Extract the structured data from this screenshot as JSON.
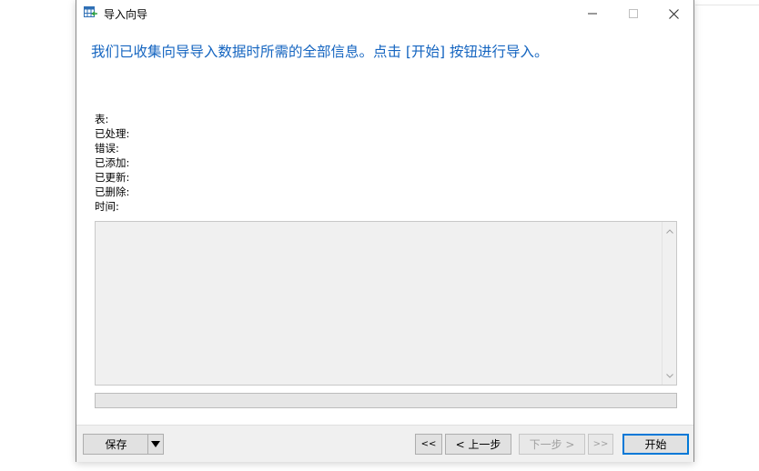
{
  "window": {
    "title": "导入向导",
    "minimize_glyph": "—",
    "maximize_glyph": "☐",
    "close_glyph": "✕"
  },
  "heading": "我们已收集向导导入数据时所需的全部信息。点击 [开始] 按钮进行导入。",
  "status_labels": {
    "table": "表:",
    "processed": "已处理:",
    "errors": "错误:",
    "added": "已添加:",
    "updated": "已更新:",
    "deleted": "已删除:",
    "time": "时间:"
  },
  "log": {
    "text": ""
  },
  "progress": {
    "value": 0
  },
  "buttons": {
    "save": "保存",
    "first": "<<",
    "prev": "< 上一步",
    "next": "下一步 >",
    "last": ">>",
    "start": "开始"
  },
  "colors": {
    "heading": "#1565c0",
    "accent": "#0078d7"
  },
  "icons": {
    "app": "table-import-icon",
    "save_dropdown": "caret-down-icon",
    "scroll_up": "chevron-up-icon",
    "scroll_down": "chevron-down-icon"
  }
}
